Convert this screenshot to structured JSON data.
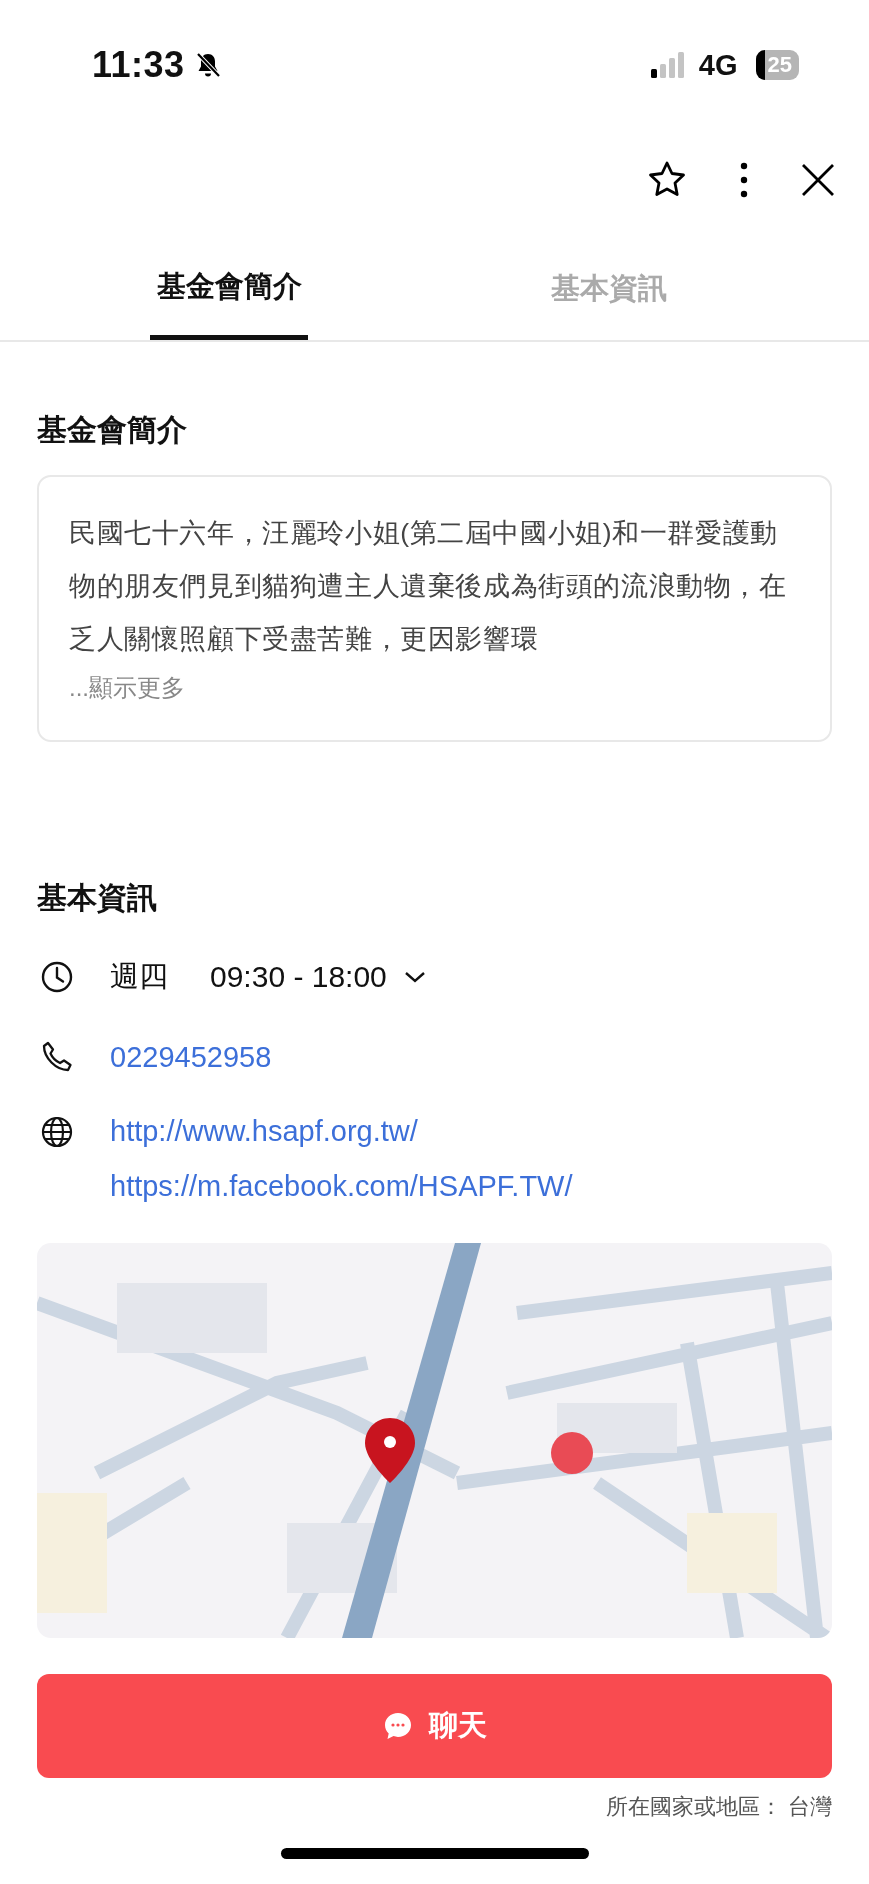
{
  "status_bar": {
    "time": "11:33",
    "silent": true,
    "network": "4G",
    "battery": "25"
  },
  "toolbar": {
    "starred": false
  },
  "tabs": [
    {
      "label": "基金會簡介",
      "selected": true
    },
    {
      "label": "基本資訊",
      "selected": false
    }
  ],
  "intro": {
    "heading": "基金會簡介",
    "text": "民國七十六年，汪麗玲小姐(第二屆中國小姐)和一群愛護動物的朋友們見到貓狗遭主人遺棄後成為街頭的流浪動物，在乏人關懷照顧下受盡苦難，更因影響環",
    "more": "...顯示更多"
  },
  "basic_info": {
    "heading": "基本資訊",
    "hours": {
      "day": "週四",
      "time": "09:30 - 18:00",
      "expanded": false
    },
    "phone": "0229452958",
    "websites": [
      "http://www.hsapf.org.tw/",
      "https://m.facebook.com/HSAPF.TW/"
    ]
  },
  "chat_button": {
    "label": "聊天"
  },
  "region": "所在國家或地區： 台灣"
}
